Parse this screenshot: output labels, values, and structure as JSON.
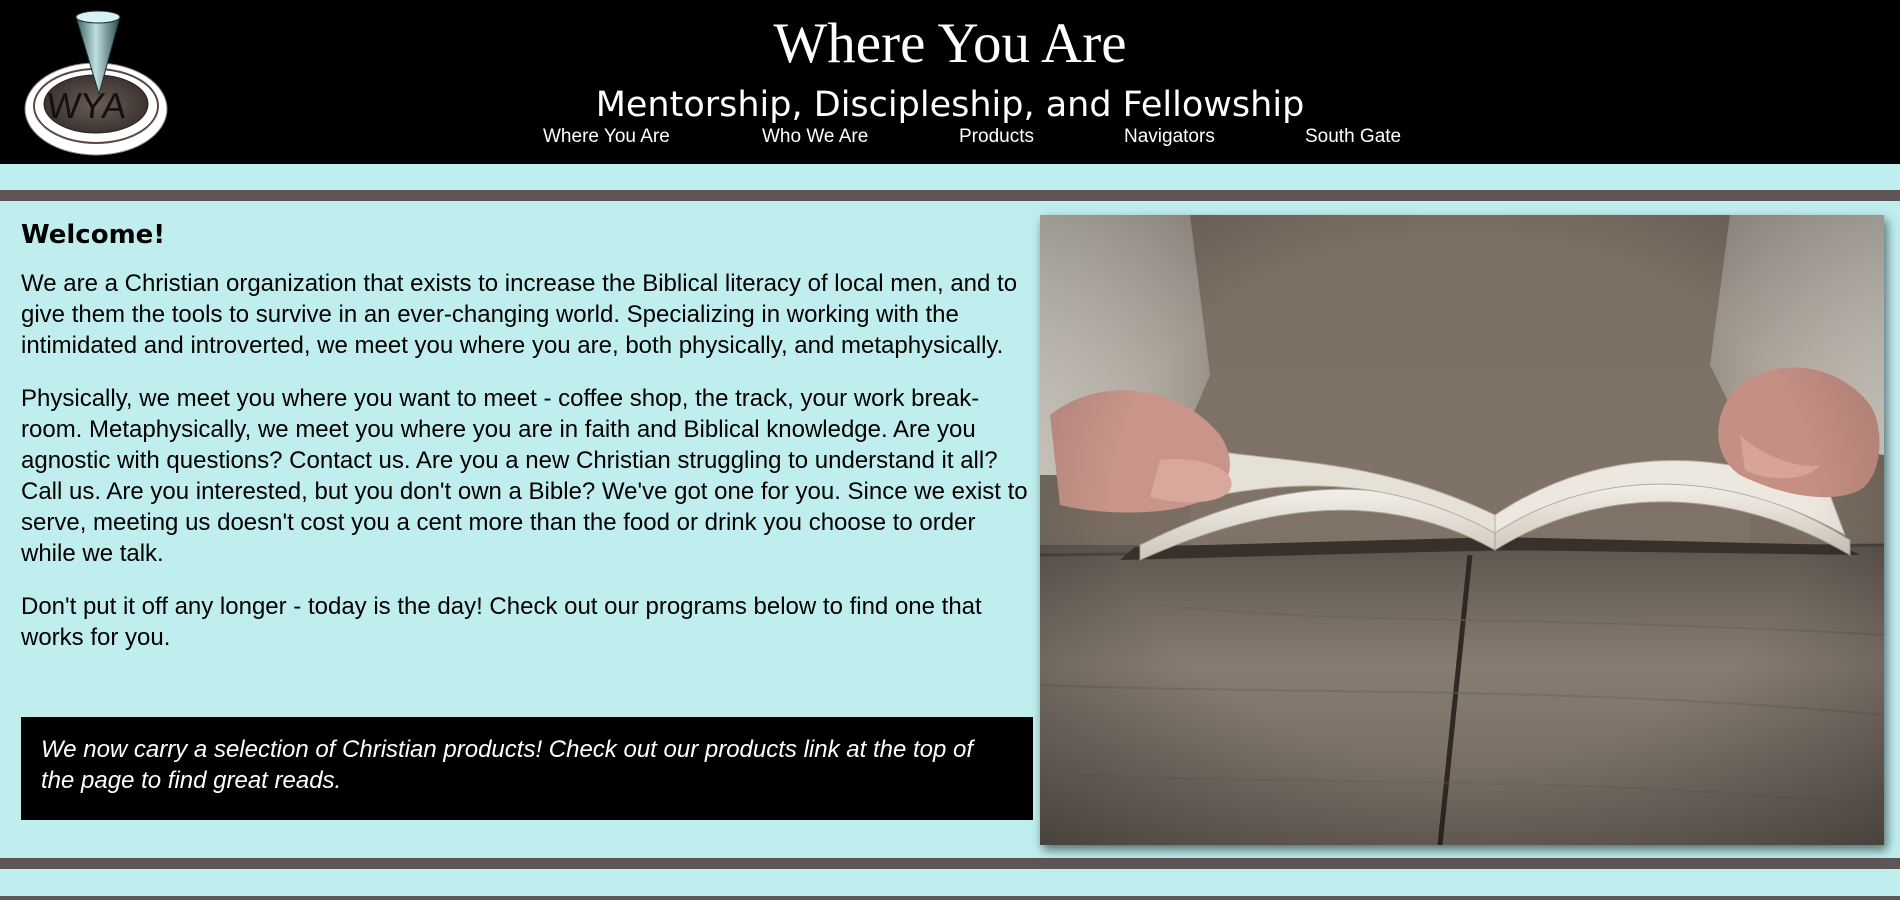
{
  "header": {
    "logo_text": "WYA",
    "title": "Where You Are",
    "subtitle": "Mentorship, Discipleship, and Fellowship",
    "nav": [
      {
        "label": "Where You Are"
      },
      {
        "label": "Who We Are"
      },
      {
        "label": "Products"
      },
      {
        "label": "Navigators"
      },
      {
        "label": "South Gate"
      }
    ]
  },
  "main": {
    "heading": "Welcome!",
    "paragraphs": [
      "We are a Christian organization that exists to increase the Biblical literacy of local men, and to give them the tools to survive in an ever-changing world. Specializing in working with the intimidated and introverted, we meet you where you are, both physically, and metaphysically.",
      "Physically, we meet you where you want to meet - coffee shop, the track, your work break-room. Metaphysically, we meet you where you are in faith and Biblical knowledge. Are you agnostic with questions? Contact us. Are you a new Christian struggling to understand it all? Call us. Are you interested, but you don't own a Bible? We've got one for you. Since we exist to serve, meeting us doesn't cost you a cent more than the food or drink you choose to order while we talk.",
      "Don't put it off any longer - today is the day! Check out our programs below to find one that works for you."
    ],
    "callout": "We now carry a selection of Christian products! Check out our products link at the top of the page to find great reads."
  },
  "colors": {
    "header_bg": "#000000",
    "page_bg": "#c0eeef",
    "stripe": "#5e5656",
    "text": "#000000",
    "callout_bg": "#000000",
    "callout_text": "#ffffff"
  },
  "icons": {
    "logo": "wya-logo-icon",
    "hero": "open-bible-photo"
  }
}
